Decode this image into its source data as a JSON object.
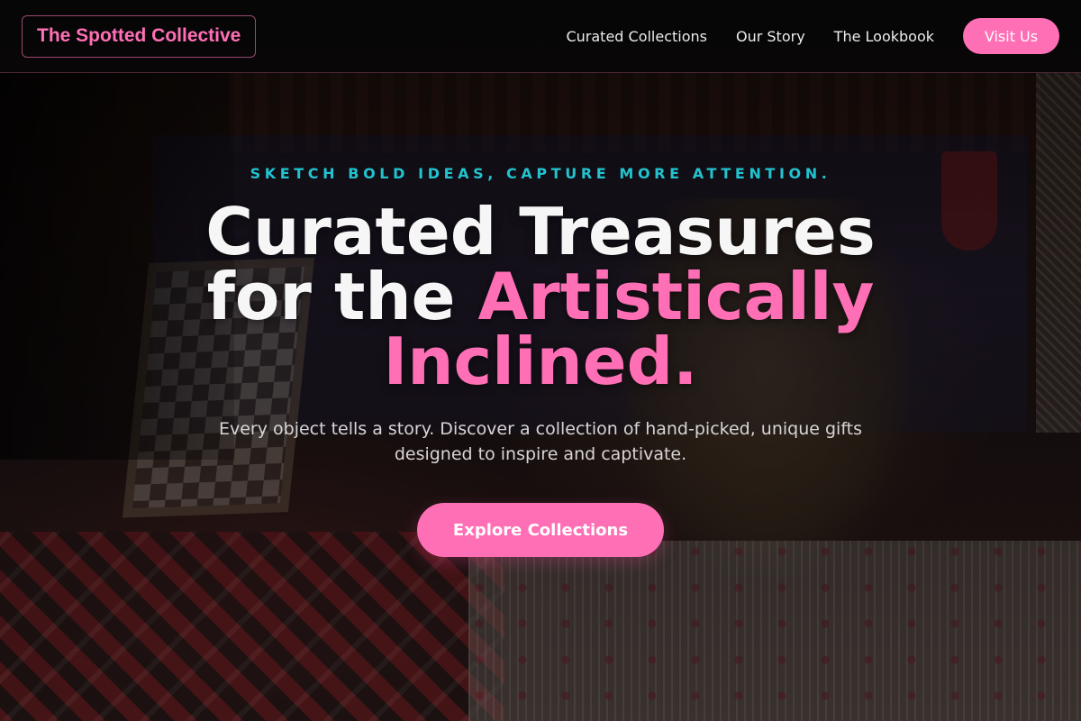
{
  "header": {
    "logo": "The Spotted Collective",
    "nav": [
      {
        "label": "Curated Collections"
      },
      {
        "label": "Our Story"
      },
      {
        "label": "The Lookbook"
      }
    ],
    "visit_label": "Visit Us"
  },
  "hero": {
    "tagline": "SKETCH BOLD IDEAS, CAPTURE MORE ATTENTION.",
    "headline_line1": "Curated Treasures",
    "headline_line2_plain": "for the ",
    "headline_line2_accent": "Artistically",
    "headline_line3_accent": "Inclined.",
    "subtitle_line1": "Every object tells a story. Discover a collection of hand-picked, unique gifts",
    "subtitle_line2": "designed to inspire and captivate.",
    "cta_label": "Explore Collections"
  },
  "colors": {
    "accent": "#ff6fb5",
    "tagline": "#22c3cf",
    "header_bg": "#080607"
  }
}
